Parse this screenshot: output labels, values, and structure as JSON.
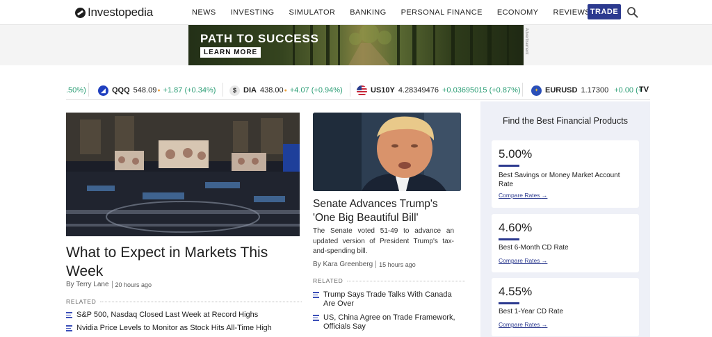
{
  "header": {
    "logo_text": "Investopedia",
    "nav": [
      "NEWS",
      "INVESTING",
      "SIMULATOR",
      "BANKING",
      "PERSONAL FINANCE",
      "ECONOMY",
      "REVIEWS"
    ],
    "trade_label": "TRADE",
    "brand_color": "#2c3a8f"
  },
  "ad": {
    "title": "PATH TO SUCCESS",
    "cta": "LEARN MORE",
    "label": "Advertisement"
  },
  "ticker": {
    "first_fragment": ".50%)",
    "items": [
      {
        "symbol": "QQQ",
        "price": "548.09",
        "change": "+1.87 (+0.34%)",
        "icon": "qqq-icon"
      },
      {
        "symbol": "DIA",
        "price": "438.00",
        "change": "+4.07 (+0.94%)",
        "icon": "dollar-icon"
      },
      {
        "symbol": "US10Y",
        "price": "4.28349476",
        "change": "+0.03695015 (+0.87%)",
        "icon": "us-flag-icon"
      },
      {
        "symbol": "EURUSD",
        "price": "1.17300",
        "change": "+0.00 (+",
        "icon": "eu-flag-icon"
      }
    ],
    "provider": "TV",
    "positive_color": "#2a9d74"
  },
  "feature_left": {
    "headline": "What to Expect in Markets This Week",
    "author": "By Terry Lane",
    "time": "20 hours ago",
    "related_label": "RELATED",
    "related": [
      "S&P 500, Nasdaq Closed Last Week at Record Highs",
      "Nvidia Price Levels to Monitor as Stock Hits All-Time High"
    ]
  },
  "feature_mid": {
    "headline": "Senate Advances Trump's 'One Big Beautiful Bill'",
    "description": "The Senate voted 51-49 to advance an updated version of President Trump's tax-and-spending bill.",
    "author": "By Kara Greenberg",
    "time": "15 hours ago",
    "related_label": "RELATED",
    "related": [
      "Trump Says Trade Talks With Canada Are Over",
      "US, China Agree on Trade Framework, Officials Say"
    ]
  },
  "products": {
    "title": "Find the Best Financial Products",
    "cards": [
      {
        "rate": "5.00%",
        "name": "Best Savings or Money Market Account Rate",
        "link": "Compare Rates"
      },
      {
        "rate": "4.60%",
        "name": "Best 6-Month CD Rate",
        "link": "Compare Rates"
      },
      {
        "rate": "4.55%",
        "name": "Best 1-Year CD Rate",
        "link": "Compare Rates"
      }
    ]
  }
}
